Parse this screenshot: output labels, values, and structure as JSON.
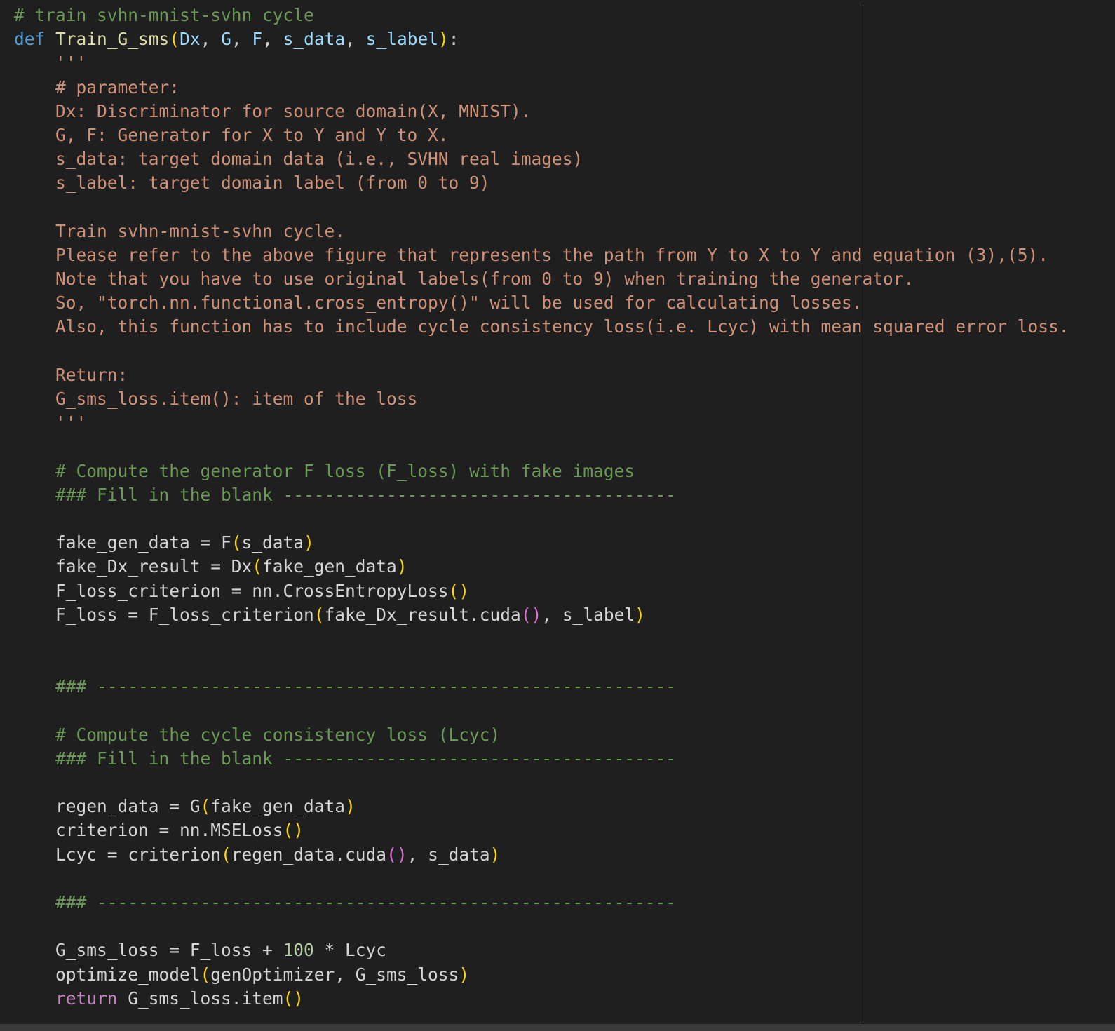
{
  "editor": {
    "lines": [
      {
        "n": "l01",
        "indent": "",
        "tokens": [
          {
            "t": "cm",
            "v": "# train svhn-mnist-svhn cycle"
          }
        ]
      },
      {
        "n": "l02",
        "indent": "",
        "tokens": [
          {
            "t": "kw",
            "v": "def"
          },
          {
            "t": "d",
            "v": " "
          },
          {
            "t": "fn",
            "v": "Train_G_sms"
          },
          {
            "t": "b1",
            "v": "("
          },
          {
            "t": "par",
            "v": "Dx"
          },
          {
            "t": "d",
            "v": ", "
          },
          {
            "t": "par",
            "v": "G"
          },
          {
            "t": "d",
            "v": ", "
          },
          {
            "t": "par",
            "v": "F"
          },
          {
            "t": "d",
            "v": ", "
          },
          {
            "t": "par",
            "v": "s_data"
          },
          {
            "t": "d",
            "v": ", "
          },
          {
            "t": "par",
            "v": "s_label"
          },
          {
            "t": "b1",
            "v": ")"
          },
          {
            "t": "d",
            "v": ":"
          }
        ]
      },
      {
        "n": "l03",
        "indent": "    ",
        "tokens": [
          {
            "t": "str",
            "v": "'''"
          }
        ]
      },
      {
        "n": "l04",
        "indent": "    ",
        "tokens": [
          {
            "t": "str",
            "v": "# parameter:"
          }
        ]
      },
      {
        "n": "l05",
        "indent": "    ",
        "tokens": [
          {
            "t": "str",
            "v": "Dx: Discriminator for source domain(X, MNIST)."
          }
        ]
      },
      {
        "n": "l06",
        "indent": "    ",
        "tokens": [
          {
            "t": "str",
            "v": "G, F: Generator for X to Y and Y to X."
          }
        ]
      },
      {
        "n": "l07",
        "indent": "    ",
        "tokens": [
          {
            "t": "str",
            "v": "s_data: target domain data (i.e., SVHN real images)"
          }
        ]
      },
      {
        "n": "l08",
        "indent": "    ",
        "tokens": [
          {
            "t": "str",
            "v": "s_label: target domain label (from 0 to 9)"
          }
        ]
      },
      {
        "n": "l09",
        "indent": "",
        "tokens": []
      },
      {
        "n": "l10",
        "indent": "    ",
        "tokens": [
          {
            "t": "str",
            "v": "Train svhn-mnist-svhn cycle."
          }
        ]
      },
      {
        "n": "l11",
        "indent": "    ",
        "tokens": [
          {
            "t": "str",
            "v": "Please refer to the above figure that represents the path from Y to X to Y and equation (3),(5)."
          }
        ]
      },
      {
        "n": "l12",
        "indent": "    ",
        "tokens": [
          {
            "t": "str",
            "v": "Note that you have to use original labels(from 0 to 9) when training the generator."
          }
        ]
      },
      {
        "n": "l13",
        "indent": "    ",
        "tokens": [
          {
            "t": "str",
            "v": "So, \"torch.nn.functional.cross_entropy()\" will be used for calculating losses."
          }
        ]
      },
      {
        "n": "l14",
        "indent": "    ",
        "tokens": [
          {
            "t": "str",
            "v": "Also, this function has to include cycle consistency loss(i.e. Lcyc) with mean squared error loss."
          }
        ]
      },
      {
        "n": "l15",
        "indent": "",
        "tokens": []
      },
      {
        "n": "l16",
        "indent": "    ",
        "tokens": [
          {
            "t": "str",
            "v": "Return:"
          }
        ]
      },
      {
        "n": "l17",
        "indent": "    ",
        "tokens": [
          {
            "t": "str",
            "v": "G_sms_loss.item(): item of the loss"
          }
        ]
      },
      {
        "n": "l18",
        "indent": "    ",
        "tokens": [
          {
            "t": "str",
            "v": "'''"
          }
        ]
      },
      {
        "n": "l19",
        "indent": "",
        "tokens": []
      },
      {
        "n": "l20",
        "indent": "    ",
        "tokens": [
          {
            "t": "cm",
            "v": "# Compute the generator F loss (F_loss) with fake images"
          }
        ]
      },
      {
        "n": "l21",
        "indent": "    ",
        "tokens": [
          {
            "t": "cm",
            "v": "### Fill in the blank --------------------------------------"
          }
        ]
      },
      {
        "n": "l22",
        "indent": "",
        "tokens": []
      },
      {
        "n": "l23",
        "indent": "    ",
        "tokens": [
          {
            "t": "d",
            "v": "fake_gen_data = F"
          },
          {
            "t": "b1",
            "v": "("
          },
          {
            "t": "d",
            "v": "s_data"
          },
          {
            "t": "b1",
            "v": ")"
          }
        ]
      },
      {
        "n": "l24",
        "indent": "    ",
        "tokens": [
          {
            "t": "d",
            "v": "fake_Dx_result = Dx"
          },
          {
            "t": "b1",
            "v": "("
          },
          {
            "t": "d",
            "v": "fake_gen_data"
          },
          {
            "t": "b1",
            "v": ")"
          }
        ]
      },
      {
        "n": "l25",
        "indent": "    ",
        "tokens": [
          {
            "t": "d",
            "v": "F_loss_criterion = nn.CrossEntropyLoss"
          },
          {
            "t": "b1",
            "v": "()"
          }
        ]
      },
      {
        "n": "l26",
        "indent": "    ",
        "tokens": [
          {
            "t": "d",
            "v": "F_loss = F_loss_criterion"
          },
          {
            "t": "b1",
            "v": "("
          },
          {
            "t": "d",
            "v": "fake_Dx_result.cuda"
          },
          {
            "t": "b2",
            "v": "()"
          },
          {
            "t": "d",
            "v": ", s_label"
          },
          {
            "t": "b1",
            "v": ")"
          }
        ]
      },
      {
        "n": "l27",
        "indent": "",
        "tokens": []
      },
      {
        "n": "l28",
        "indent": "",
        "tokens": []
      },
      {
        "n": "l29",
        "indent": "    ",
        "tokens": [
          {
            "t": "cm",
            "v": "### --------------------------------------------------------"
          }
        ]
      },
      {
        "n": "l30",
        "indent": "",
        "tokens": []
      },
      {
        "n": "l31",
        "indent": "    ",
        "tokens": [
          {
            "t": "cm",
            "v": "# Compute the cycle consistency loss (Lcyc)"
          }
        ]
      },
      {
        "n": "l32",
        "indent": "    ",
        "tokens": [
          {
            "t": "cm",
            "v": "### Fill in the blank --------------------------------------"
          }
        ]
      },
      {
        "n": "l33",
        "indent": "",
        "tokens": []
      },
      {
        "n": "l34",
        "indent": "    ",
        "tokens": [
          {
            "t": "d",
            "v": "regen_data = G"
          },
          {
            "t": "b1",
            "v": "("
          },
          {
            "t": "d",
            "v": "fake_gen_data"
          },
          {
            "t": "b1",
            "v": ")"
          }
        ]
      },
      {
        "n": "l35",
        "indent": "    ",
        "tokens": [
          {
            "t": "d",
            "v": "criterion = nn.MSELoss"
          },
          {
            "t": "b1",
            "v": "()"
          }
        ]
      },
      {
        "n": "l36",
        "indent": "    ",
        "tokens": [
          {
            "t": "d",
            "v": "Lcyc = criterion"
          },
          {
            "t": "b1",
            "v": "("
          },
          {
            "t": "d",
            "v": "regen_data.cuda"
          },
          {
            "t": "b2",
            "v": "()"
          },
          {
            "t": "d",
            "v": ", s_data"
          },
          {
            "t": "b1",
            "v": ")"
          }
        ]
      },
      {
        "n": "l37",
        "indent": "",
        "tokens": []
      },
      {
        "n": "l38",
        "indent": "    ",
        "tokens": [
          {
            "t": "cm",
            "v": "### --------------------------------------------------------"
          }
        ]
      },
      {
        "n": "l39",
        "indent": "",
        "tokens": []
      },
      {
        "n": "l40",
        "indent": "    ",
        "tokens": [
          {
            "t": "d",
            "v": "G_sms_loss = F_loss + "
          },
          {
            "t": "num",
            "v": "100"
          },
          {
            "t": "d",
            "v": " * Lcyc"
          }
        ]
      },
      {
        "n": "l41",
        "indent": "    ",
        "tokens": [
          {
            "t": "d",
            "v": "optimize_model"
          },
          {
            "t": "b1",
            "v": "("
          },
          {
            "t": "d",
            "v": "genOptimizer, G_sms_loss"
          },
          {
            "t": "b1",
            "v": ")"
          }
        ]
      },
      {
        "n": "l42",
        "indent": "    ",
        "tokens": [
          {
            "t": "kw2",
            "v": "return"
          },
          {
            "t": "d",
            "v": " G_sms_loss.item"
          },
          {
            "t": "b1",
            "v": "()"
          }
        ]
      }
    ]
  }
}
